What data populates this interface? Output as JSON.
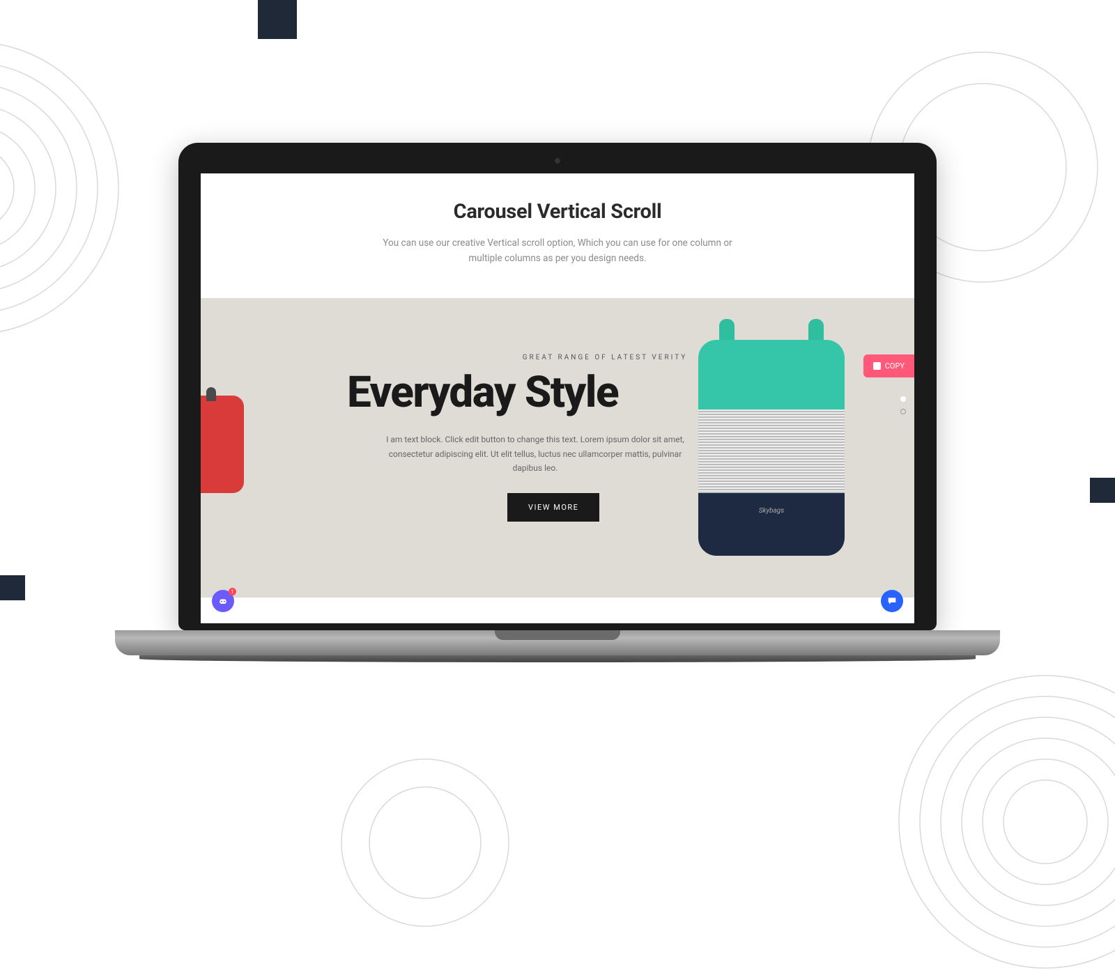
{
  "header": {
    "title": "Carousel Vertical Scroll",
    "subtitle": "You can use our creative Vertical scroll option, Which you can use for one column or multiple columns as per you design needs."
  },
  "hero": {
    "eyebrow": "GREAT RANGE OF LATEST VERITY",
    "title": "Everyday Style",
    "body": "I am text block. Click edit button to change this text. Lorem ipsum dolor sit amet, consectetur adipiscing elit. Ut elit tellus, luctus nec ullamcorper mattis, pulvinar dapibus leo.",
    "cta": "VIEW MORE"
  },
  "copy_tab": {
    "label": "COPY"
  },
  "assistant_badge": "1",
  "products": {
    "main": {
      "brand": "Skybags"
    }
  },
  "carousel": {
    "active_index": 0,
    "count": 2
  }
}
